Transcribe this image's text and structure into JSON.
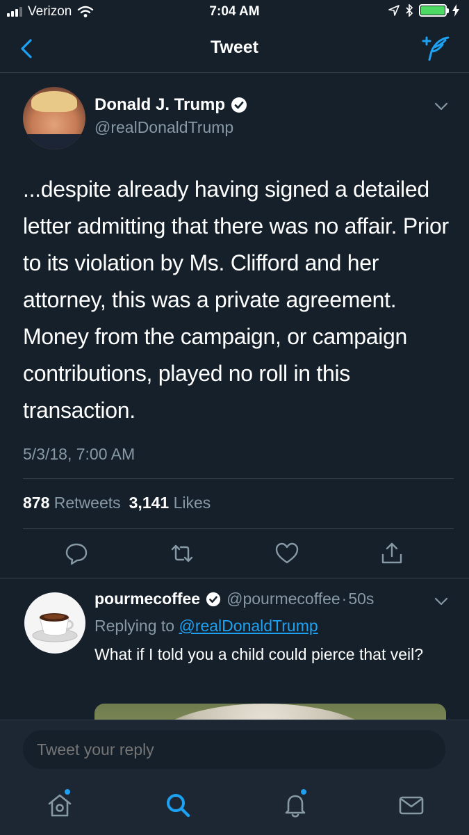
{
  "status": {
    "carrier": "Verizon",
    "time": "7:04 AM",
    "battery_color": "#4cd964"
  },
  "nav": {
    "title": "Tweet",
    "back_icon": "chevron-left-icon",
    "compose_icon": "compose-tweet-icon"
  },
  "tweet": {
    "author_name": "Donald J. Trump",
    "author_handle": "@realDonaldTrump",
    "text": "...despite already having signed a detailed letter admitting that there was no affair. Prior to its violation by Ms. Clifford and her attorney, this was a private agreement. Money from the campaign, or campaign contributions, played no roll in this transaction.",
    "date": "5/3/18, 7:00 AM",
    "retweets_count": "878",
    "retweets_label": "Retweets",
    "likes_count": "3,141",
    "likes_label": "Likes"
  },
  "reply": {
    "author_name": "pourmecoffee",
    "author_handle": "@pourmecoffee",
    "separator": "·",
    "time_ago": "50s",
    "replying_label": "Replying to",
    "replying_to": "@realDonaldTrump",
    "text": "What if I told you a child could pierce that veil?"
  },
  "compose": {
    "placeholder": "Tweet your reply"
  },
  "tabs": [
    "home-icon",
    "search-icon",
    "notifications-icon",
    "messages-icon"
  ],
  "colors": {
    "background": "#15202b",
    "accent": "#1da1f2",
    "secondary_text": "#8899a6",
    "divider": "#38444d"
  }
}
